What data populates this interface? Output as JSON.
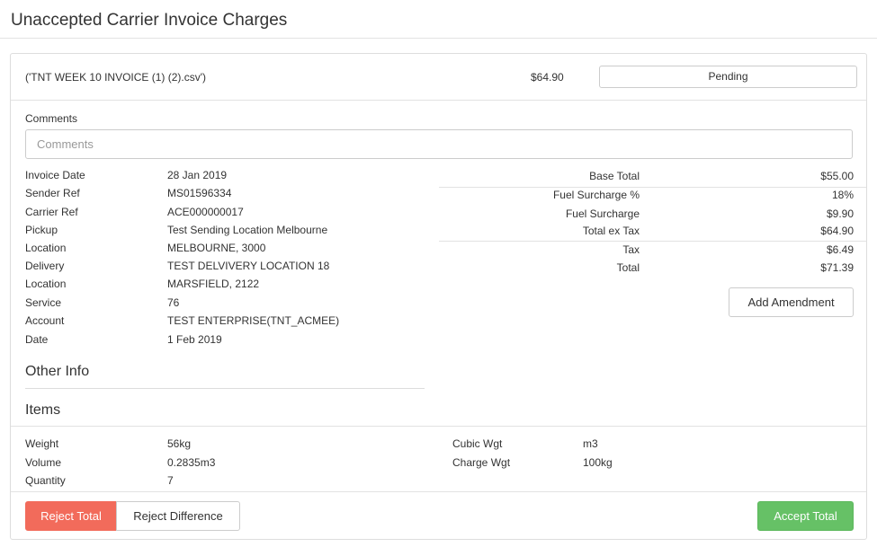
{
  "page": {
    "title": "Unaccepted Carrier Invoice Charges"
  },
  "invoice": {
    "file_name": "('TNT WEEK 10 INVOICE (1) (2).csv')",
    "amount": "$64.90",
    "status": "Pending"
  },
  "comments": {
    "label": "Comments",
    "placeholder": "Comments",
    "value": ""
  },
  "details": [
    {
      "label": "Invoice Date",
      "value": "28 Jan 2019"
    },
    {
      "label": "Sender Ref",
      "value": "MS01596334"
    },
    {
      "label": "Carrier Ref",
      "value": "ACE000000017"
    },
    {
      "label": "Pickup",
      "value": "Test Sending Location Melbourne"
    },
    {
      "label": "Location",
      "value": "MELBOURNE, 3000"
    },
    {
      "label": "Delivery",
      "value": "TEST DELVIVERY LOCATION 18"
    },
    {
      "label": "Location",
      "value": "MARSFIELD, 2122"
    },
    {
      "label": "Service",
      "value": "76"
    },
    {
      "label": "Account",
      "value": "TEST ENTERPRISE(TNT_ACMEE)"
    },
    {
      "label": "Date",
      "value": "1 Feb 2019"
    }
  ],
  "totals": [
    {
      "label": "Base Total",
      "value": "$55.00"
    },
    {
      "label": "Fuel Surcharge %",
      "value": "18%"
    },
    {
      "label": "Fuel Surcharge",
      "value": "$9.90"
    },
    {
      "label": "Total ex Tax",
      "value": "$64.90"
    },
    {
      "label": "Tax",
      "value": "$6.49"
    },
    {
      "label": "Total",
      "value": "$71.39"
    }
  ],
  "actions": {
    "add_amendment": "Add Amendment",
    "reject_total": "Reject Total",
    "reject_difference": "Reject Difference",
    "accept_total": "Accept Total"
  },
  "sections": {
    "other_info": "Other Info",
    "items": "Items"
  },
  "items_left": [
    {
      "label": "Weight",
      "value": "56kg"
    },
    {
      "label": "Volume",
      "value": "0.2835m3"
    },
    {
      "label": "Quantity",
      "value": "7"
    }
  ],
  "items_right": [
    {
      "label": "Cubic Wgt",
      "value": "m3"
    },
    {
      "label": "Charge Wgt",
      "value": "100kg"
    }
  ],
  "colors": {
    "reject": "#f26b5b",
    "accept": "#66c166",
    "border": "#cccccc"
  }
}
